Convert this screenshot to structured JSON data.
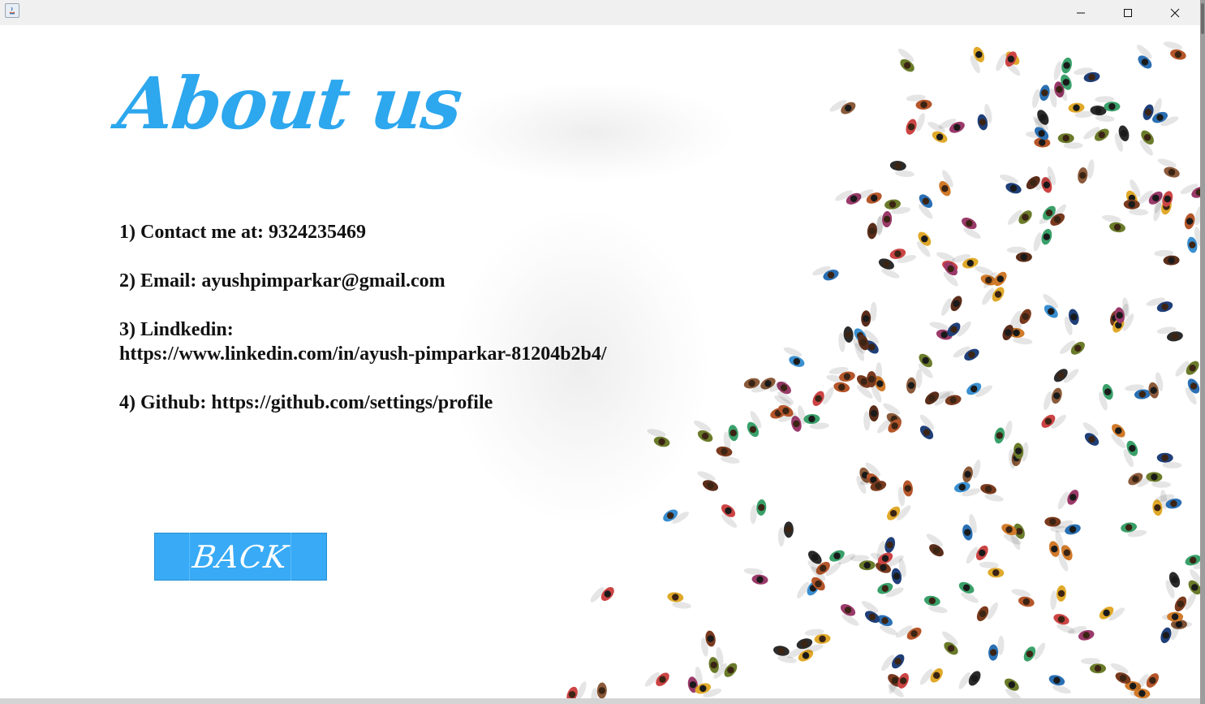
{
  "window": {
    "minimize_symbol": "—",
    "maximize_symbol": "☐",
    "close_symbol": "✕"
  },
  "page": {
    "heading": "About us",
    "contact": "1) Contact me at: 9324235469",
    "email": "2) Email: ayushpimparkar@gmail.com",
    "linkedin_label": "3) Lindkedin:",
    "linkedin_url": "https://www.linkedin.com/in/ayush-pimparkar-81204b2b4/",
    "github": "4) Github: https://github.com/settings/profile"
  },
  "back_button": {
    "label": "BACK"
  },
  "colors": {
    "heading": "#2da7ee",
    "button": "#38aaf6",
    "text": "#111111",
    "titlebar": "#f0f0f0"
  },
  "background_image": {
    "description_icon": "crowd-illustration"
  }
}
